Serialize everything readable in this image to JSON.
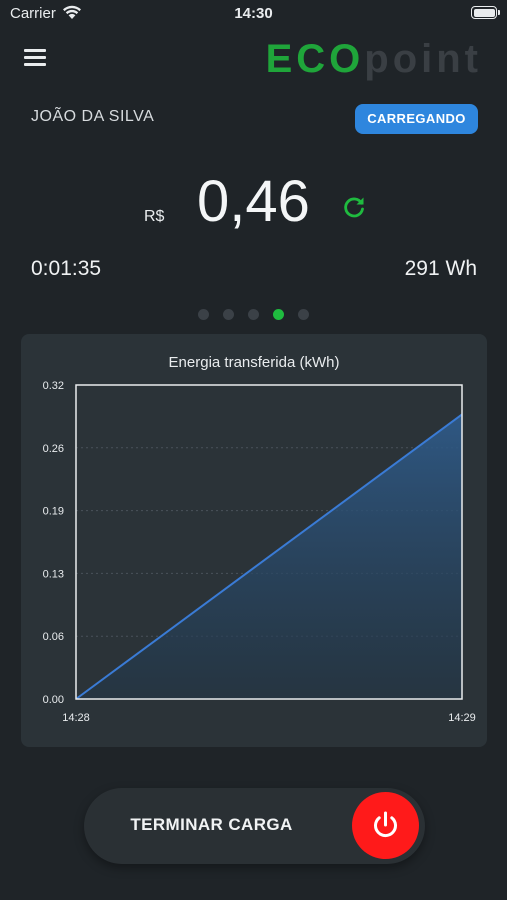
{
  "status_bar": {
    "carrier": "Carrier",
    "time": "14:30"
  },
  "header": {
    "logo_part1": "ECO",
    "logo_part2": "point",
    "menu_icon": "hamburger-menu-icon"
  },
  "session": {
    "user_name": "JOÃO DA SILVA",
    "status": "CARREGANDO",
    "currency": "R$",
    "price": "0,46",
    "elapsed": "0:01:35",
    "energy": "291 Wh",
    "refresh_icon": "refresh-icon"
  },
  "pager": {
    "count": 5,
    "active_index": 3
  },
  "chart_data": {
    "type": "area",
    "title": "Energia transferida (kWh)",
    "x": [
      "14:28",
      "14:29"
    ],
    "x_tick_labels": [
      "14:28",
      "14:29"
    ],
    "y_tick_labels": [
      "0.32",
      "0.26",
      "0.19",
      "0.13",
      "0.06",
      "0.00"
    ],
    "series": [
      {
        "values": [
          0.0,
          0.29
        ]
      }
    ],
    "ylim": [
      0,
      0.32
    ],
    "grid": "horizontal-dashed",
    "color": "#3a7bd5"
  },
  "actions": {
    "stop_label": "TERMINAR CARGA",
    "power_icon": "power-icon"
  },
  "colors": {
    "accent_green": "#1fbb3f",
    "badge_blue": "#2e86de",
    "stop_red": "#ff1a1a"
  }
}
